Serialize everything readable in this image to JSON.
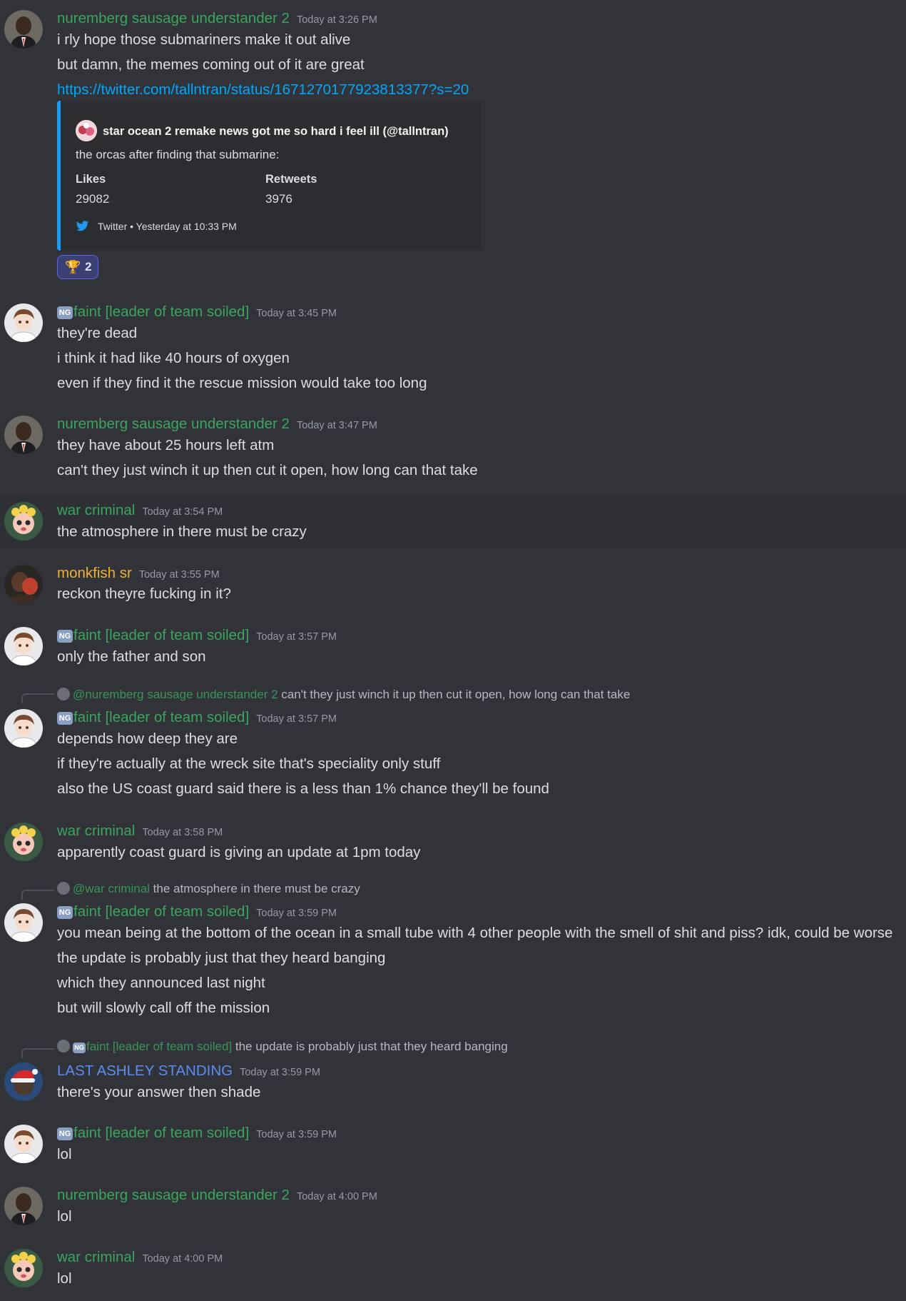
{
  "messages": [
    {
      "user": "nuremberg sausage understander 2",
      "time": "Today at 3:26 PM",
      "lines": [
        "i rly hope those submariners make it out alive",
        "but damn, the memes coming out of it are great"
      ],
      "link": "https://twitter.com/tallntran/status/1671270177923813377?s=20",
      "embed": {
        "author": "star ocean 2 remake news got me so hard i feel ill (@tallntran)",
        "description": "the orcas after finding that submarine:",
        "fields": [
          {
            "name": "Likes",
            "value": "29082"
          },
          {
            "name": "Retweets",
            "value": "3976"
          }
        ],
        "footer_source": "Twitter",
        "footer_time": "Yesterday at 10:33 PM"
      },
      "reaction": {
        "emoji": "🏆",
        "count": "2"
      }
    },
    {
      "badge": "NG",
      "user": "faint [leader of team soiled]",
      "time": "Today at 3:45 PM",
      "lines": [
        "they're dead",
        "i think it had like 40 hours of oxygen",
        "even if they find it the rescue mission would take too long"
      ]
    },
    {
      "user": "nuremberg sausage understander 2",
      "time": "Today at 3:47 PM",
      "lines": [
        "they have about 25 hours left atm",
        "can't they just winch it up then cut it open, how long can that take"
      ]
    },
    {
      "user": "war criminal",
      "time": "Today at 3:54 PM",
      "lines": [
        "the atmosphere in there must be crazy"
      ]
    },
    {
      "user": "monkfish sr",
      "time": "Today at 3:55 PM",
      "lines": [
        "reckon theyre fucking in it?"
      ]
    },
    {
      "badge": "NG",
      "user": "faint [leader of team soiled]",
      "time": "Today at 3:57 PM",
      "lines": [
        "only the father and son"
      ]
    },
    {
      "reply_to": "@nuremberg sausage understander 2",
      "reply_text": "can't they just winch it up then cut it open, how long can that take",
      "badge": "NG",
      "user": "faint [leader of team soiled]",
      "time": "Today at 3:57 PM",
      "lines": [
        "depends how deep they are",
        "if they're actually at the wreck site that's speciality only stuff",
        "also the US coast guard said there is a less than 1% chance they'll be found"
      ]
    },
    {
      "user": "war criminal",
      "time": "Today at 3:58 PM",
      "lines": [
        "apparently coast guard is giving an update at 1pm today"
      ]
    },
    {
      "reply_to": "@war criminal",
      "reply_text": "the atmosphere in there must be crazy",
      "badge": "NG",
      "user": "faint [leader of team soiled]",
      "time": "Today at 3:59 PM",
      "lines": [
        "you mean being at the bottom of the ocean in a small tube with 4 other people with the smell of shit and piss? idk, could be worse",
        "the update is probably just that they heard banging",
        "which they announced last night",
        "but will slowly call off the mission"
      ]
    },
    {
      "reply_badge": "NG",
      "reply_to": "faint [leader of team soiled]",
      "reply_text": "the update is probably just that they heard banging",
      "user": "LAST ASHLEY STANDING",
      "time": "Today at 3:59 PM",
      "lines": [
        "there's your answer then shade"
      ]
    },
    {
      "badge": "NG",
      "user": "faint [leader of team soiled]",
      "time": "Today at 3:59 PM",
      "lines": [
        "lol"
      ]
    },
    {
      "user": "nuremberg sausage understander 2",
      "time": "Today at 4:00 PM",
      "lines": [
        "lol"
      ]
    },
    {
      "user": "war criminal",
      "time": "Today at 4:00 PM",
      "lines": [
        "lol"
      ]
    }
  ],
  "colors": {
    "background": "#313338",
    "username_green": "#3ba55d",
    "username_gold": "#f0b232",
    "username_blue": "#5b8def",
    "link": "#00a8fc",
    "embed_border": "#1d9bf0"
  },
  "icons": {
    "embed_footer": "twitter-bird-icon",
    "reaction": "trophy-emoji"
  }
}
